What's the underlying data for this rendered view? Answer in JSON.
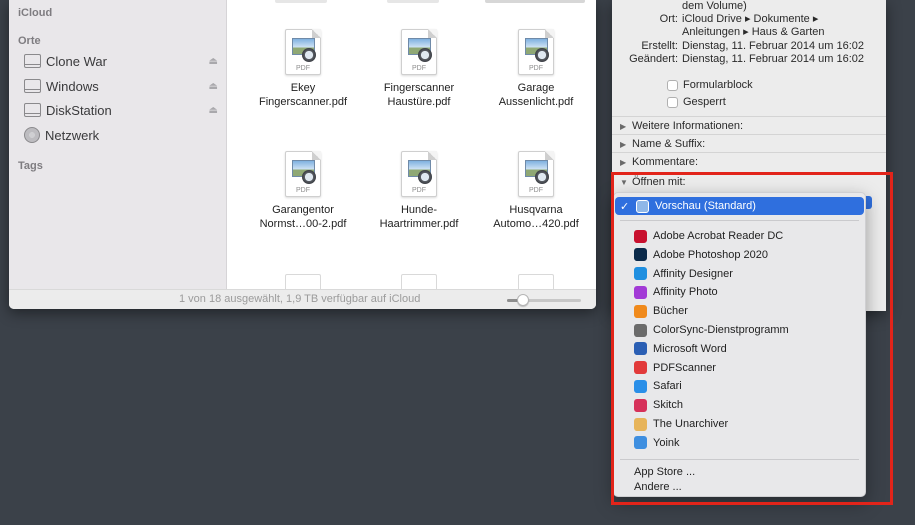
{
  "finder": {
    "sidebar": {
      "icloud_header": "iCloud",
      "places_header": "Orte",
      "places": [
        {
          "label": "Clone War",
          "icon": "drive-icon",
          "eject": "⏏"
        },
        {
          "label": "Windows",
          "icon": "drive-icon",
          "eject": "⏏"
        },
        {
          "label": "DiskStation",
          "icon": "drive-icon",
          "eject": "⏏"
        },
        {
          "label": "Netzwerk",
          "icon": "network-globe-icon",
          "eject": ""
        }
      ],
      "tags_header": "Tags"
    },
    "files": [
      {
        "name_line1": "Ekey",
        "name_line2": "Fingerscanner.pdf",
        "badge": "PDF"
      },
      {
        "name_line1": "Fingerscanner",
        "name_line2": "Haustüre.pdf",
        "badge": "PDF"
      },
      {
        "name_line1": "Garage",
        "name_line2": "Aussenlicht.pdf",
        "badge": "PDF"
      },
      {
        "name_line1": "Garangentor",
        "name_line2": "Normst…00-2.pdf",
        "badge": "PDF"
      },
      {
        "name_line1": "Hunde-",
        "name_line2": "Haartrimmer.pdf",
        "badge": "PDF"
      },
      {
        "name_line1": "Husqvarna",
        "name_line2": "Automo…420.pdf",
        "badge": "PDF"
      }
    ],
    "status_text": "1 von 18 ausgewählt, 1,9 TB verfügbar auf iCloud",
    "icon_size_fraction": 0.22
  },
  "info": {
    "volume_line": "dem Volume)",
    "ort_label": "Ort:",
    "ort_line1": "iCloud Drive ▸ Dokumente ▸",
    "ort_line2": "Anleitungen ▸ Haus & Garten",
    "created_label": "Erstellt:",
    "created_value": "Dienstag, 11. Februar 2014 um 16:02",
    "modified_label": "Geändert:",
    "modified_value": "Dienstag, 11. Februar 2014 um 16:02",
    "formularblock": "Formularblock",
    "gesperrt": "Gesperrt",
    "sections": [
      {
        "label": "Weitere Informationen:",
        "expanded": false
      },
      {
        "label": "Name & Suffix:",
        "expanded": false
      },
      {
        "label": "Kommentare:",
        "expanded": false
      },
      {
        "label": "Öffnen mit:",
        "expanded": true
      }
    ]
  },
  "open_with_menu": {
    "selected": {
      "label": "Vorschau (Standard)",
      "check": "✓"
    },
    "apps": [
      {
        "label": "Adobe Acrobat Reader DC",
        "icon": "acrobat-icon",
        "color": "#c8102e"
      },
      {
        "label": "Adobe Photoshop 2020",
        "icon": "photoshop-icon",
        "color": "#0b2a4a"
      },
      {
        "label": "Affinity Designer",
        "icon": "affinity-designer-icon",
        "color": "#1f8fe0"
      },
      {
        "label": "Affinity Photo",
        "icon": "affinity-photo-icon",
        "color": "#a23ad6"
      },
      {
        "label": "Bücher",
        "icon": "books-icon",
        "color": "#f08a1c"
      },
      {
        "label": "ColorSync-Dienstprogramm",
        "icon": "colorsync-icon",
        "color": "#6b6b6b"
      },
      {
        "label": "Microsoft Word",
        "icon": "word-icon",
        "color": "#2b5fb4"
      },
      {
        "label": "PDFScanner",
        "icon": "pdfscanner-icon",
        "color": "#e23a3a"
      },
      {
        "label": "Safari",
        "icon": "safari-icon",
        "color": "#2a8fe8"
      },
      {
        "label": "Skitch",
        "icon": "skitch-icon",
        "color": "#d6315a"
      },
      {
        "label": "The Unarchiver",
        "icon": "unarchiver-icon",
        "color": "#e7b45a"
      },
      {
        "label": "Yoink",
        "icon": "yoink-icon",
        "color": "#3f8fe0"
      }
    ],
    "app_store": "App Store ...",
    "other": "Andere ..."
  },
  "colors": {
    "selection": "#2f6fde",
    "highlight_box": "#e2241a",
    "desktop": "#3b4149"
  }
}
